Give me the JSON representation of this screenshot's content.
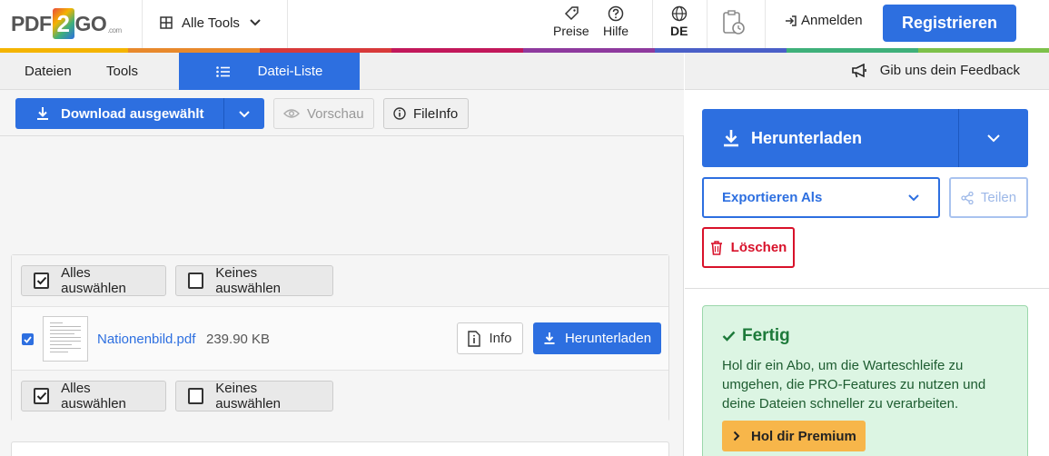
{
  "header": {
    "logo": {
      "pdf": "PDF",
      "two": "2",
      "go": "GO",
      "com": ".com"
    },
    "all_tools": "Alle Tools",
    "prices": "Preise",
    "help": "Hilfe",
    "language": "DE",
    "login": "Anmelden",
    "register": "Registrieren"
  },
  "tabs": {
    "files": "Dateien",
    "tools": "Tools",
    "file_list": "Datei-Liste"
  },
  "toolbar": {
    "download_selected": "Download ausgewählt",
    "preview": "Vorschau",
    "fileinfo": "FileInfo"
  },
  "file_list": {
    "select_all": "Alles auswählen",
    "select_none": "Keines auswählen",
    "file": {
      "name": "Nationenbild.pdf",
      "size": "239.90 KB",
      "info": "Info",
      "download": "Herunterladen"
    }
  },
  "right_panel": {
    "feedback": "Gib uns dein Feedback",
    "download": "Herunterladen",
    "export_as": "Exportieren Als",
    "share": "Teilen",
    "delete": "Löschen",
    "done": {
      "title": "Fertig",
      "text": "Hol dir ein Abo, um die Warteschleife zu umgehen, die PRO-Features zu nutzen und deine Dateien schneller zu verarbeiten.",
      "premium": "Hol dir Premium"
    }
  },
  "colors": {
    "primary": "#2d6fe0",
    "danger": "#d8112a",
    "success_bg": "#dcf5e3",
    "success_text": "#1d7a3a",
    "premium": "#f7b64a",
    "brand_stripe": [
      "#f4b400",
      "#e8892c",
      "#d83a3a",
      "#c2185b",
      "#8e3a9e",
      "#4a5fc8",
      "#2d6fe0",
      "#3fb07a",
      "#7dc14a"
    ]
  }
}
